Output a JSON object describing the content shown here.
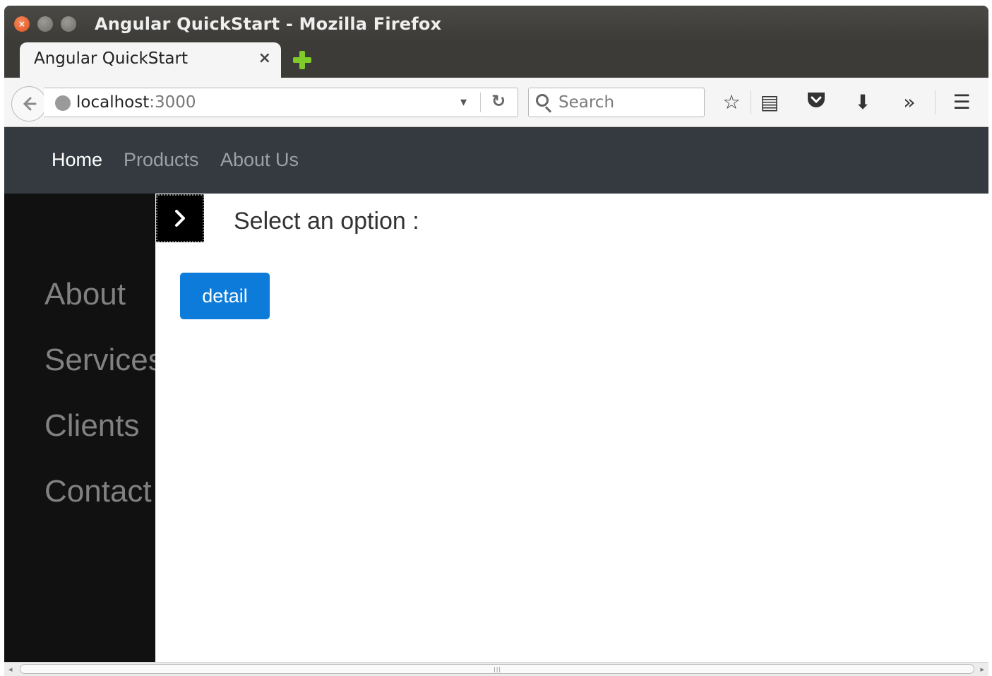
{
  "window": {
    "title": "Angular QuickStart - Mozilla Firefox",
    "close_symbol": "×"
  },
  "tabs": [
    {
      "label": "Angular QuickStart",
      "close_symbol": "×"
    }
  ],
  "toolbar": {
    "back_symbol": "🡐",
    "url_host": "localhost",
    "url_port": ":3000",
    "url_dropdown_symbol": "▾",
    "reload_symbol": "↻",
    "search_placeholder": "Search",
    "icons": [
      "bookmark-star-icon",
      "reading-list-icon",
      "pocket-icon",
      "download-icon",
      "overflow-icon",
      "menu-icon"
    ],
    "bookmark_symbol": "☆",
    "reading_symbol": "▤",
    "download_symbol": "⬇",
    "overflow_symbol": "»",
    "menu_symbol": "☰"
  },
  "site_nav": {
    "home": "Home",
    "products": "Products",
    "about_us": "About Us"
  },
  "sidebar": {
    "items": [
      {
        "label": "About"
      },
      {
        "label": "Services"
      },
      {
        "label": "Clients"
      },
      {
        "label": "Contact"
      }
    ]
  },
  "main": {
    "toggle_symbol": "›",
    "title": "Select an option :",
    "detail_button": "detail"
  },
  "colors": {
    "navbar_bg": "#343a40",
    "sidebar_bg": "#111111",
    "primary_button": "#0c7bd9",
    "window_chrome": "#3c3b37"
  }
}
